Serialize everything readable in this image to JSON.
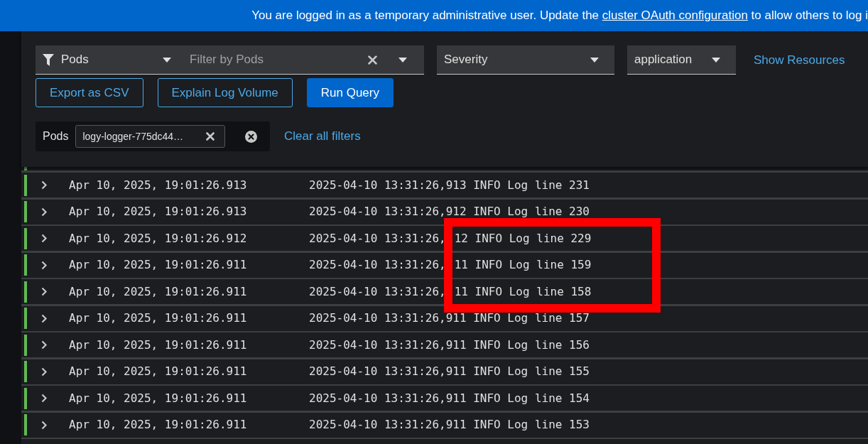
{
  "banner": {
    "text": "You are logged in as a temporary administrative user. Update the ",
    "link": "cluster OAuth configuration",
    "text_after": " to allow others to log i"
  },
  "filters": {
    "attribute": "Pods",
    "search": {
      "placeholder": "Filter by Pods"
    },
    "severity": "Severity",
    "tenant": "application",
    "show_resources": "Show Resources"
  },
  "buttons": [
    {
      "label": "Export as CSV",
      "kind": "secondary"
    },
    {
      "label": "Explain Log Volume",
      "kind": "secondary"
    },
    {
      "label": "Run Query",
      "kind": "primary"
    }
  ],
  "chip_group": {
    "category": "Pods",
    "chips": [
      "logy-logger-775dc44…"
    ],
    "clear_all": "Clear all filters"
  },
  "log_rows": [
    {
      "time": "Apr 10, 2025, 19:01:26.913",
      "message": [
        "2025-04-10 13:31:26,913 INFO Log line 231"
      ],
      "highlighted": false
    },
    {
      "time": "Apr 10, 2025, 19:01:26.913",
      "message": [
        "2025-04-10 13:31:26,912 INFO Log line 230"
      ],
      "highlighted": false
    },
    {
      "time": "Apr 10, 2025, 19:01:26.912",
      "message": [
        "2025-04-10 13:31:26,",
        "12 INFO Log line 229"
      ],
      "highlighted": true
    },
    {
      "time": "Apr 10, 2025, 19:01:26.911",
      "message": [
        "2025-04-10 13:31:26,",
        "11 INFO Log line 159"
      ],
      "highlighted": true
    },
    {
      "time": "Apr 10, 2025, 19:01:26.911",
      "message": [
        "2025-04-10 13:31:26,",
        "11 INFO Log line 158"
      ],
      "highlighted": true
    },
    {
      "time": "Apr 10, 2025, 19:01:26.911",
      "message": [
        "2025-04-10 13:31:26,911 INFO Log line 157"
      ],
      "highlighted": false
    },
    {
      "time": "Apr 10, 2025, 19:01:26.911",
      "message": [
        "2025-04-10 13:31:26,911 INFO Log line 156"
      ],
      "highlighted": false
    },
    {
      "time": "Apr 10, 2025, 19:01:26.911",
      "message": [
        "2025-04-10 13:31:26,911 INFO Log line 155"
      ],
      "highlighted": false
    },
    {
      "time": "Apr 10, 2025, 19:01:26.911",
      "message": [
        "2025-04-10 13:31:26,911 INFO Log line 154"
      ],
      "highlighted": false
    },
    {
      "time": "Apr 10, 2025, 19:01:26.911",
      "message": [
        "2025-04-10 13:31:26,911 INFO Log line 153"
      ],
      "highlighted": false
    }
  ]
}
